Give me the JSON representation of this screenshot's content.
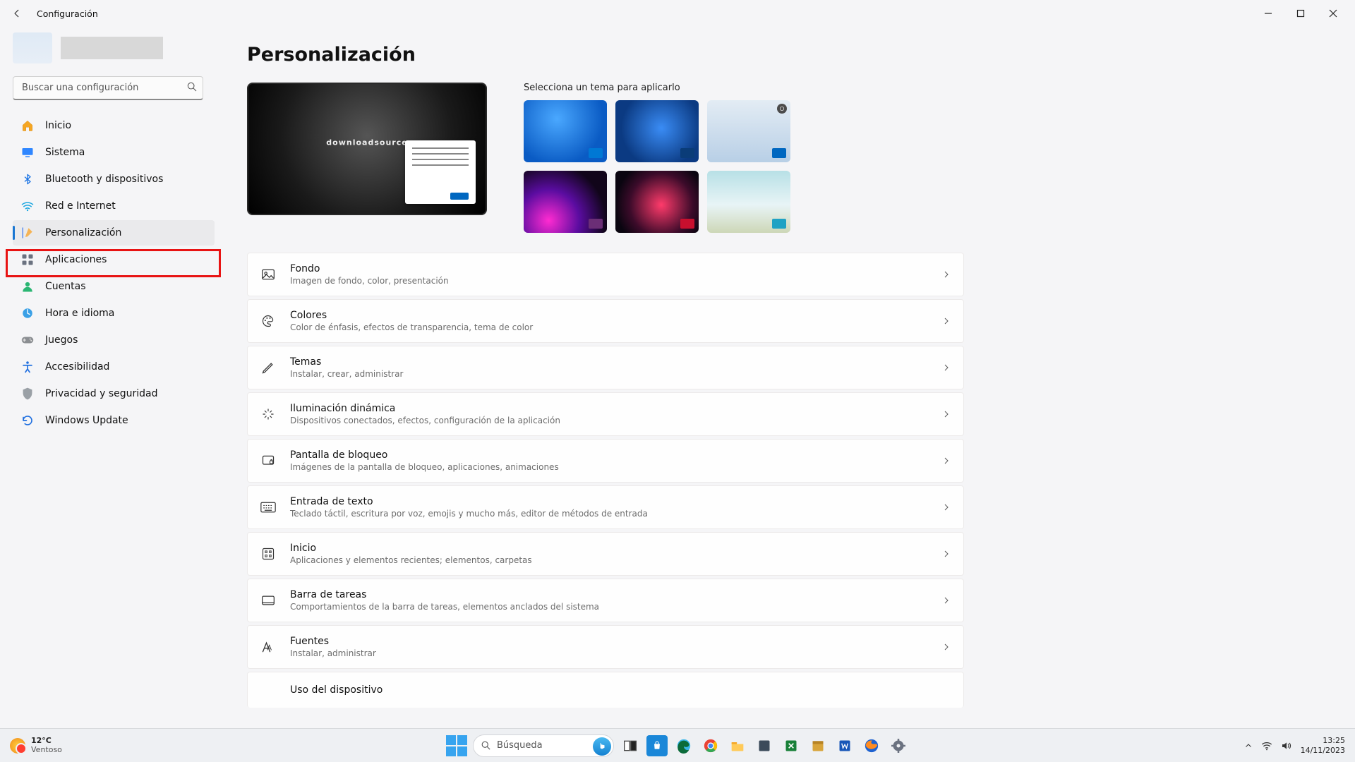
{
  "window": {
    "title": "Configuración"
  },
  "search": {
    "placeholder": "Buscar una configuración"
  },
  "nav": {
    "home": "Inicio",
    "system": "Sistema",
    "bluetooth": "Bluetooth y dispositivos",
    "network": "Red e Internet",
    "personalization": "Personalización",
    "apps": "Aplicaciones",
    "accounts": "Cuentas",
    "time": "Hora e idioma",
    "gaming": "Juegos",
    "accessibility": "Accesibilidad",
    "privacy": "Privacidad y seguridad",
    "update": "Windows Update"
  },
  "page": {
    "title": "Personalización",
    "themes_label": "Selecciona un tema para aplicarlo",
    "preview_brand": "downloadsource"
  },
  "rows": {
    "background": {
      "title": "Fondo",
      "desc": "Imagen de fondo, color, presentación"
    },
    "colors": {
      "title": "Colores",
      "desc": "Color de énfasis, efectos de transparencia, tema de color"
    },
    "themes": {
      "title": "Temas",
      "desc": "Instalar, crear, administrar"
    },
    "dynamic": {
      "title": "Iluminación dinámica",
      "desc": "Dispositivos conectados, efectos, configuración de la aplicación"
    },
    "lockscreen": {
      "title": "Pantalla de bloqueo",
      "desc": "Imágenes de la pantalla de bloqueo, aplicaciones, animaciones"
    },
    "textinput": {
      "title": "Entrada de texto",
      "desc": "Teclado táctil, escritura por voz, emojis y mucho más, editor de métodos de entrada"
    },
    "start": {
      "title": "Inicio",
      "desc": "Aplicaciones y elementos recientes; elementos, carpetas"
    },
    "taskbar": {
      "title": "Barra de tareas",
      "desc": "Comportamientos de la barra de tareas, elementos anclados del sistema"
    },
    "fonts": {
      "title": "Fuentes",
      "desc": "Instalar, administrar"
    },
    "usage": {
      "title": "Uso del dispositivo"
    }
  },
  "taskbar": {
    "temp": "12°C",
    "weather": "Ventoso",
    "search": "Búsqueda",
    "time": "13:25",
    "date": "14/11/2023"
  }
}
